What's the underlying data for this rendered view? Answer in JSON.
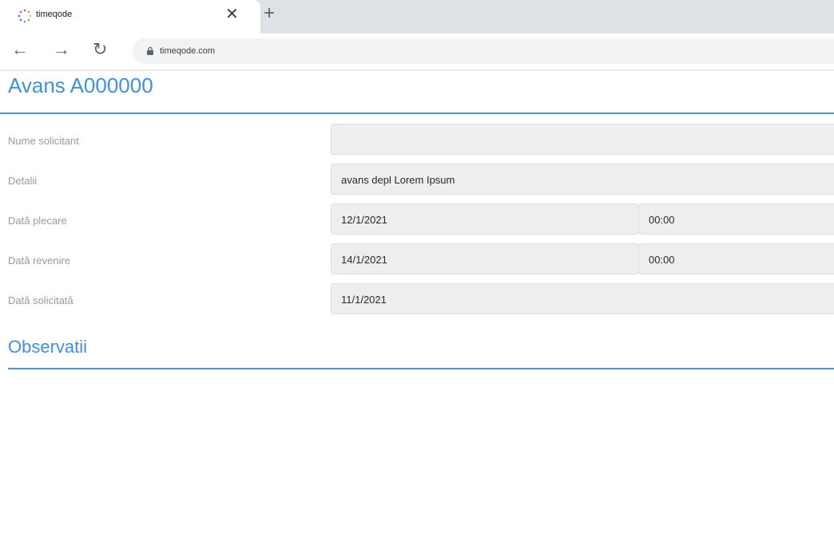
{
  "browser": {
    "tab_title": "timeqode",
    "close_icon": "close-icon",
    "new_tab_icon": "plus-icon",
    "url": "timeqode.com"
  },
  "page": {
    "title": "Avans A000000",
    "fields": [
      {
        "label": "Nume solicitant",
        "value": ""
      },
      {
        "label": "Detalii",
        "value": "avans depl Lorem Ipsum"
      },
      {
        "label": "Dată plecare",
        "value": "12/1/2021",
        "time": "00:00"
      },
      {
        "label": "Dată revenire",
        "value": "14/1/2021",
        "time": "00:00"
      },
      {
        "label": "Dată solicitată",
        "value": "11/1/2021"
      }
    ],
    "section_title": "Observatii"
  },
  "colors": {
    "accent": "#3b8ff0",
    "field_bg": "#eceeef",
    "label": "#9a9a9a"
  }
}
